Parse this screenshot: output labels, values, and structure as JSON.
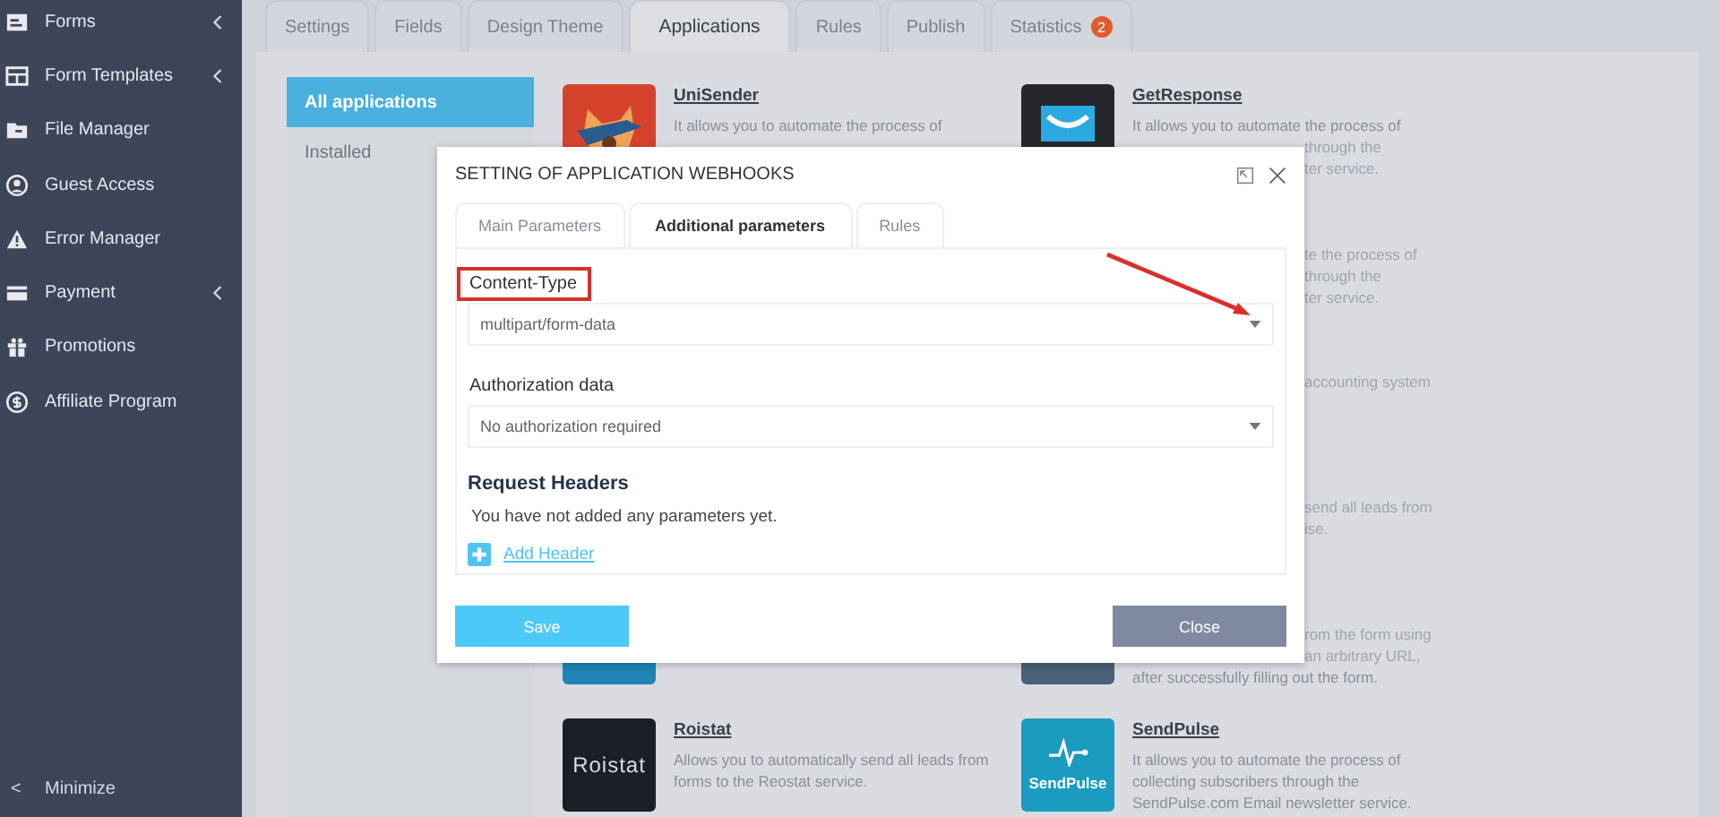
{
  "sidebar": {
    "items": [
      {
        "label": "Forms",
        "kind": "form",
        "has_submenu": true
      },
      {
        "label": "Form Templates",
        "kind": "template",
        "has_submenu": true
      },
      {
        "label": "File Manager",
        "kind": "folder",
        "has_submenu": false
      },
      {
        "label": "Guest Access",
        "kind": "user",
        "has_submenu": false
      },
      {
        "label": "Error Manager",
        "kind": "warning",
        "has_submenu": false
      },
      {
        "label": "Payment",
        "kind": "card",
        "has_submenu": true
      },
      {
        "label": "Promotions",
        "kind": "gift",
        "has_submenu": false
      },
      {
        "label": "Affiliate Program",
        "kind": "dollar",
        "has_submenu": false
      }
    ],
    "minimize": {
      "icon": "<",
      "label": "Minimize"
    }
  },
  "tabs": [
    {
      "label": "Settings",
      "selected": false
    },
    {
      "label": "Fields",
      "selected": false
    },
    {
      "label": "Design Theme",
      "selected": false
    },
    {
      "label": "Applications",
      "selected": true
    },
    {
      "label": "Rules",
      "selected": false
    },
    {
      "label": "Publish",
      "selected": false
    },
    {
      "label": "Statistics",
      "selected": false,
      "badge": "2"
    }
  ],
  "app_filters": [
    {
      "label": "All applications",
      "selected": true
    },
    {
      "label": "Installed",
      "selected": false
    }
  ],
  "apps": [
    {
      "kind": "mascot",
      "title": "UniSender",
      "lines": [
        {
          "text": "It allows you to automate the process of",
          "clipped": false
        }
      ]
    },
    {
      "kind": "envelope",
      "title": "GetResponse",
      "lines": [
        {
          "text": "It allows you to automate the process of",
          "clipped": false
        },
        {
          "text": "through the",
          "clipped": true
        },
        {
          "text": "ter service.",
          "clipped": true
        }
      ]
    },
    {
      "lines": [
        {
          "text": "te the process of",
          "clipped": true
        },
        {
          "text": "through the",
          "clipped": true
        },
        {
          "text": "ter service.",
          "clipped": true
        }
      ]
    },
    {
      "lines": [
        {
          "text": "accounting system",
          "clipped": true
        }
      ]
    },
    {
      "lines": [
        {
          "text": "send all leads from",
          "clipped": true
        },
        {
          "text": "ise.",
          "clipped": true
        }
      ]
    },
    {
      "kind": "blue-tile"
    },
    {
      "kind": "slate-tile",
      "lines": [
        {
          "text": "rom the form using",
          "clipped": true
        },
        {
          "text": "an arbitrary URL,",
          "clipped": true
        },
        {
          "text": "after successfully filling out the form.",
          "clipped": false
        }
      ]
    },
    {
      "kind": "roistat",
      "logo_text": "Roistat",
      "title": "Roistat",
      "lines": [
        {
          "text": "Allows you to automatically send all leads from",
          "clipped": false
        },
        {
          "text": "forms to the Reostat service.",
          "clipped": false
        }
      ]
    },
    {
      "kind": "sendpulse",
      "logo_text": "SendPulse",
      "title": "SendPulse",
      "lines": [
        {
          "text": "It allows you to automate the process of",
          "clipped": false
        },
        {
          "text": "collecting subscribers through the",
          "clipped": false
        },
        {
          "text": "SendPulse.com Email newsletter service.",
          "clipped": false
        }
      ]
    }
  ],
  "modal": {
    "title": "SETTING OF APPLICATION WEBHOOKS",
    "tabs": [
      {
        "label": "Main Parameters",
        "selected": false
      },
      {
        "label": "Additional parameters",
        "selected": true
      },
      {
        "label": "Rules",
        "selected": false
      }
    ],
    "content_type": {
      "label": "Content-Type",
      "highlighted": true,
      "value": "multipart/form-data"
    },
    "authorization": {
      "label": "Authorization data",
      "value": "No authorization required"
    },
    "request_headers": {
      "heading": "Request Headers",
      "empty_text": "You have not added any parameters yet.",
      "add_link": "Add Header"
    },
    "buttons": [
      {
        "label": "Save",
        "kind": "primary"
      },
      {
        "label": "Close",
        "kind": "secondary"
      }
    ]
  }
}
